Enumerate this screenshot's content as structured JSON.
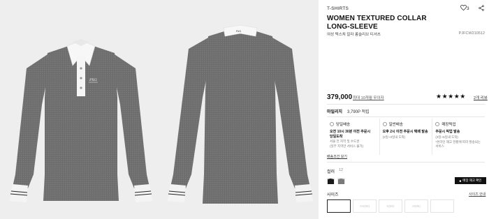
{
  "product": {
    "category": "T-SHIRTS",
    "likes": "3",
    "title": "WOMEN TEXTURED COLLAR LONG-SLEEVE",
    "subtitle": "여성 텍스쳐 칼라 롱슬리브 티셔츠",
    "sku": "PJFCW210512",
    "price": "379,000",
    "installment": "최대 10개월 무이자",
    "rating_stars": "★★★★★",
    "reviews": "2개 리뷰",
    "images": [
      {
        "name": "front-view",
        "color": "#6f6f6f"
      },
      {
        "name": "back-view",
        "color": "#6f6f6f"
      }
    ]
  },
  "mileage": {
    "label": "마일리지",
    "value": "3,790P 적립"
  },
  "delivery": {
    "options": [
      {
        "name": "당일배송",
        "line1": "오전 10시 30분 이전 주문시",
        "line2": "당일도착",
        "note1": "서울 전 지역 및 수도권",
        "note2": "(일부 지역만 서비스 불가)"
      },
      {
        "name": "일반배송",
        "line1": "오후 2시 이전 주문시 택배 발송",
        "line2": "",
        "note1": "(2일~3일내 도착)",
        "note2": ""
      },
      {
        "name": "매장픽업",
        "line1": "주문시 픽업 발송",
        "line2": "",
        "note1": "(3일~5일내 도착)",
        "note2": "*온라인 재고 현황에 따라 발송되는 서비스"
      }
    ],
    "link": "배송조건 보기"
  },
  "color": {
    "label": "컬러",
    "count": "12",
    "swatches": [
      {
        "name": "black",
        "hex": "#1a1a1a"
      },
      {
        "name": "gray",
        "hex": "#7a7a7a"
      }
    ],
    "store_button": "매장 재고 확인"
  },
  "size": {
    "label": "사이즈",
    "guide": "사이즈 안내",
    "options": [
      "",
      "XS(85)",
      "S(90)",
      "M(95)",
      ""
    ]
  }
}
